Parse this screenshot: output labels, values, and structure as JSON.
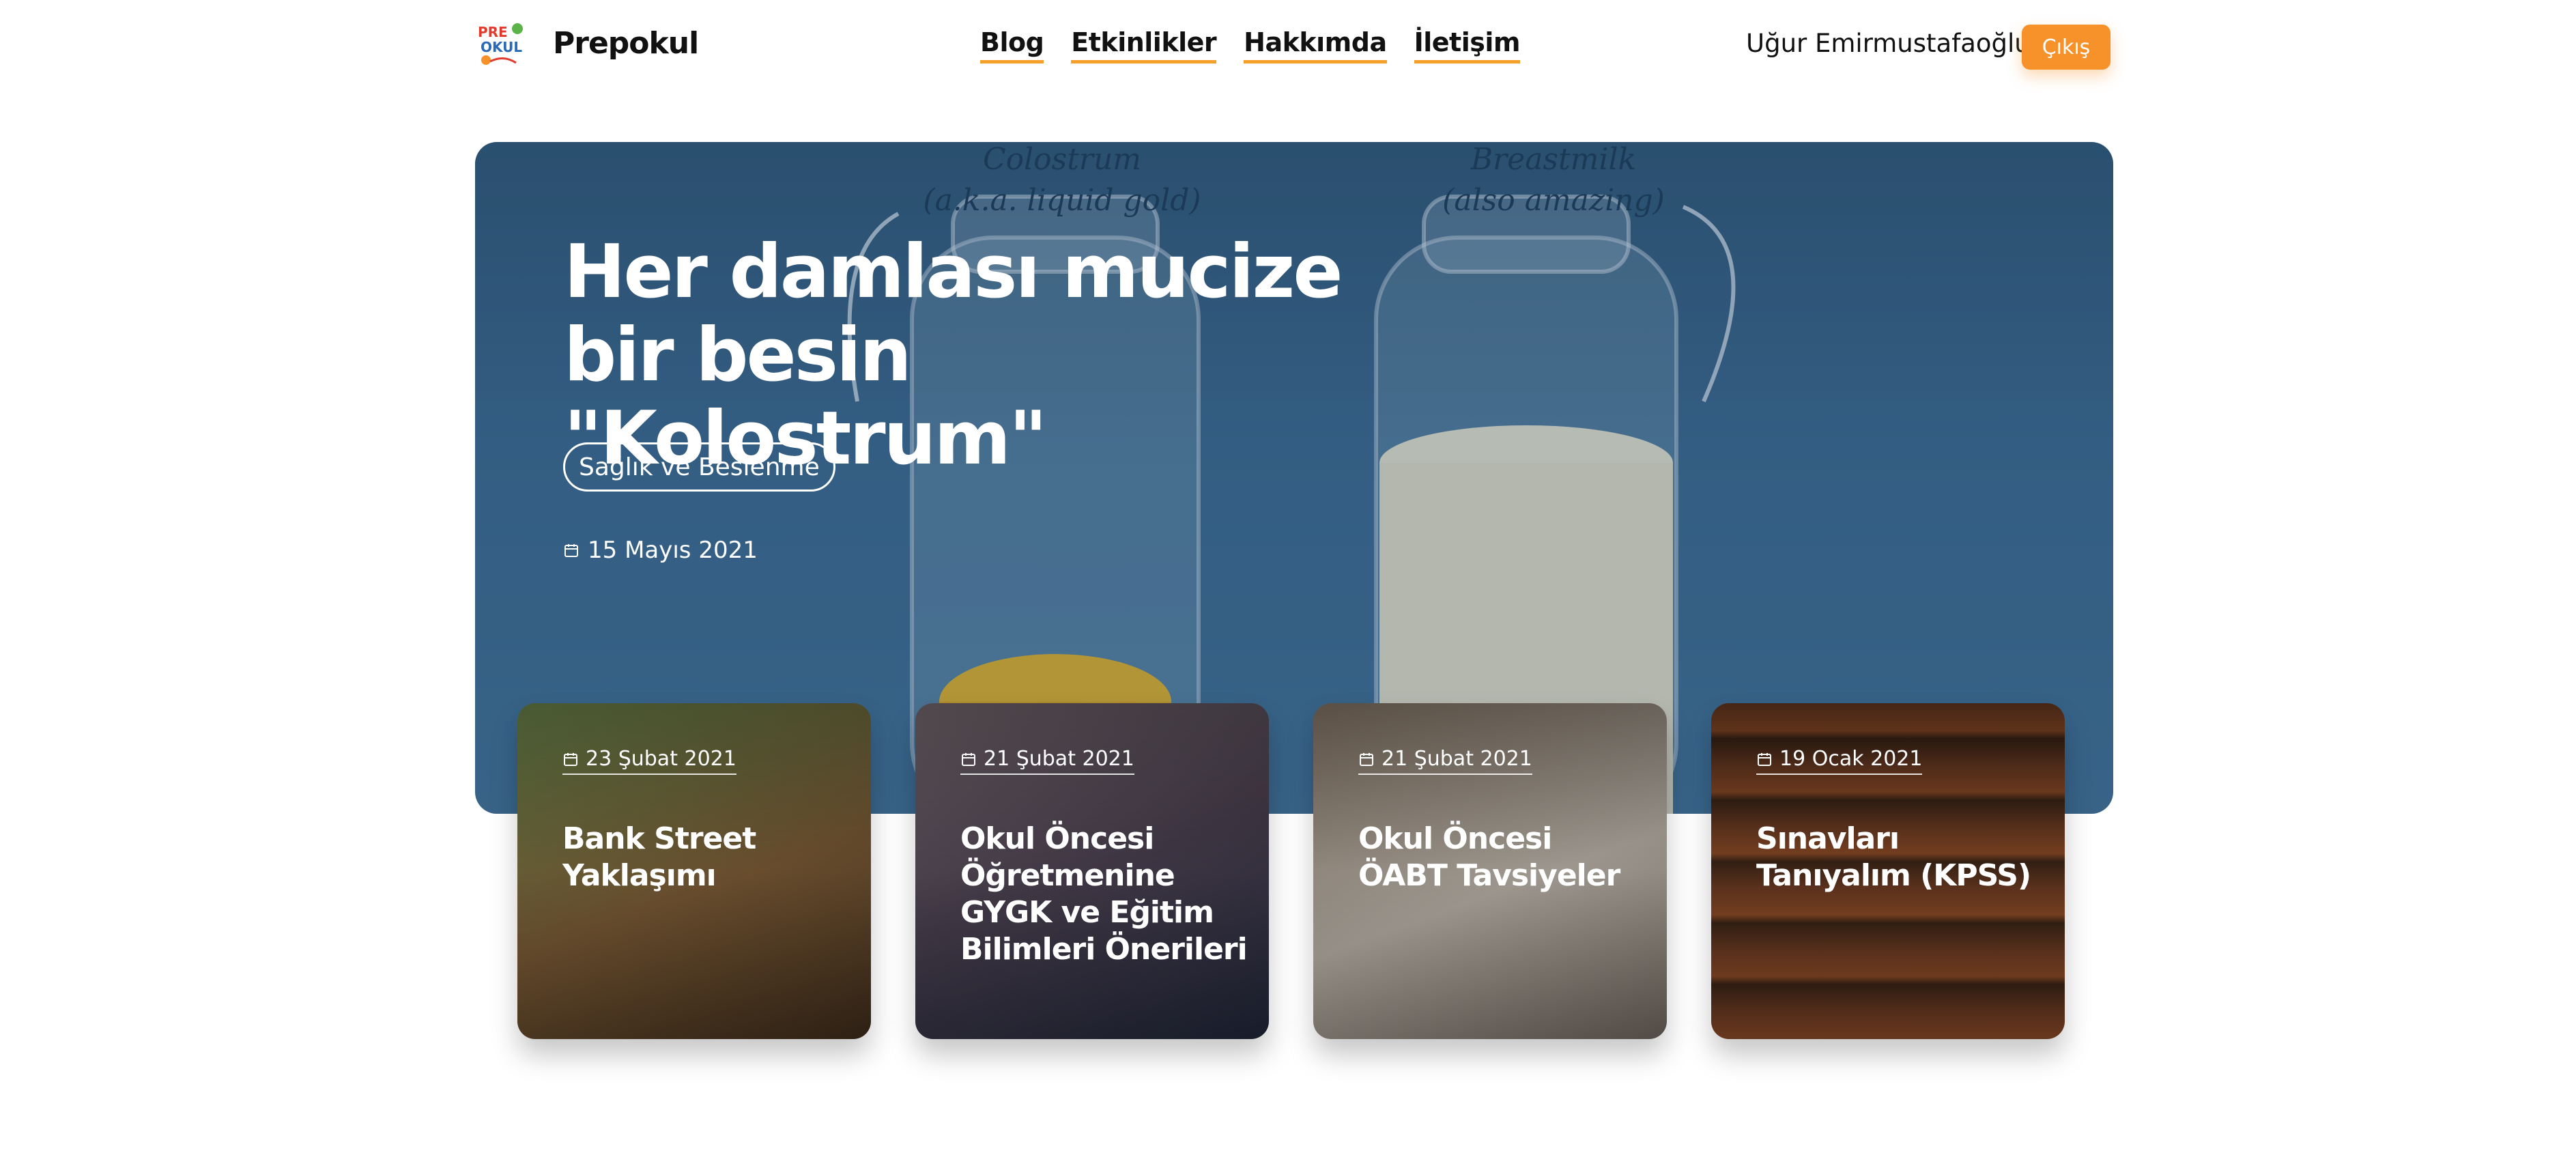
{
  "header": {
    "brand": "Prepokul",
    "nav": [
      "Blog",
      "Etkinlikler",
      "Hakkımda",
      "İletişim"
    ],
    "user_name": "Uğur Emirmustafaoğlu",
    "logout_label": "Çıkış"
  },
  "hero": {
    "title": "Her damlası mucize bir besin \"Kolostrum\"",
    "category": "Sağlık ve Beslenme",
    "date": "15 Mayıs 2021",
    "image_text": {
      "left_caption_line1": "Colostrum",
      "left_caption_line2": "(a.k.a. liquid gold)",
      "right_caption_line1": "Breastmilk",
      "right_caption_line2": "(also amazing)"
    }
  },
  "cards": [
    {
      "date": "23 Şubat 2021",
      "title": "Bank Street Yaklaşımı"
    },
    {
      "date": "21 Şubat 2021",
      "title": "Okul Öncesi Öğretmenine GYGK ve Eğitim Bilimleri Önerileri"
    },
    {
      "date": "21 Şubat 2021",
      "title": "Okul Öncesi ÖABT Tavsiyeler"
    },
    {
      "date": "19 Ocak 2021",
      "title": "Sınavları Tanıyalım (KPSS)"
    }
  ],
  "colors": {
    "accent": "#f7922a",
    "nav_underline": "#f5a02a",
    "hero_bg": "#3e6e96"
  }
}
